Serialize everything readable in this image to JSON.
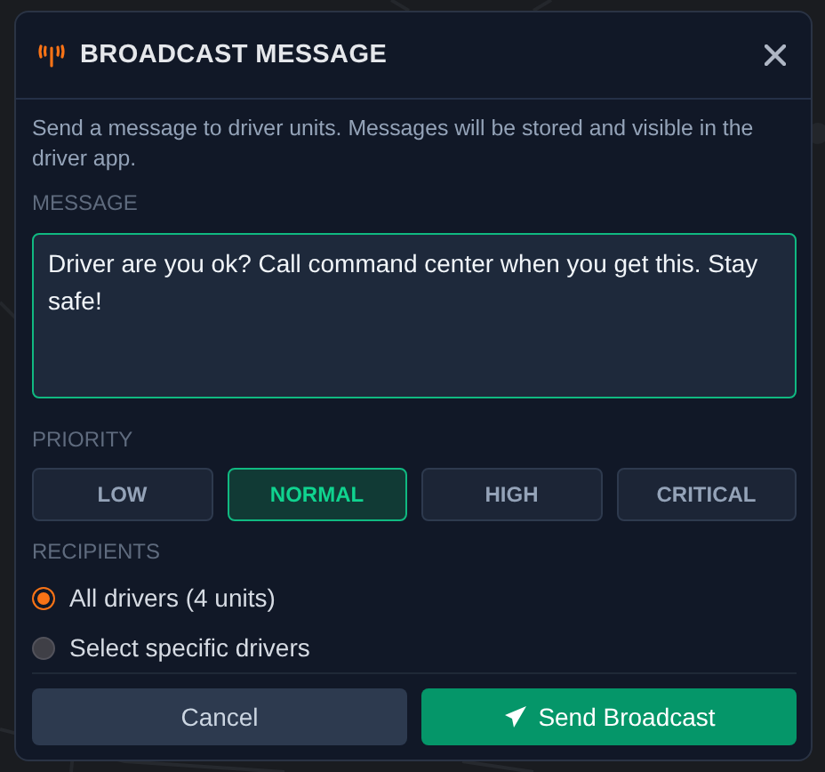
{
  "dialog": {
    "title": "BROADCAST MESSAGE",
    "description": "Send a message to driver units. Messages will be stored and visible in the driver app.",
    "message": {
      "label": "MESSAGE",
      "value": "Driver are you ok? Call command center when you get this. Stay safe!"
    },
    "priority": {
      "label": "PRIORITY",
      "options": [
        {
          "label": "LOW",
          "selected": false
        },
        {
          "label": "NORMAL",
          "selected": true
        },
        {
          "label": "HIGH",
          "selected": false
        },
        {
          "label": "CRITICAL",
          "selected": false
        }
      ]
    },
    "recipients": {
      "label": "RECIPIENTS",
      "options": [
        {
          "label": "All drivers (4 units)",
          "selected": true
        },
        {
          "label": "Select specific drivers",
          "selected": false
        }
      ]
    },
    "buttons": [
      {
        "kind": "secondary",
        "label": "Cancel"
      },
      {
        "kind": "primary",
        "label": "Send Broadcast"
      }
    ]
  }
}
